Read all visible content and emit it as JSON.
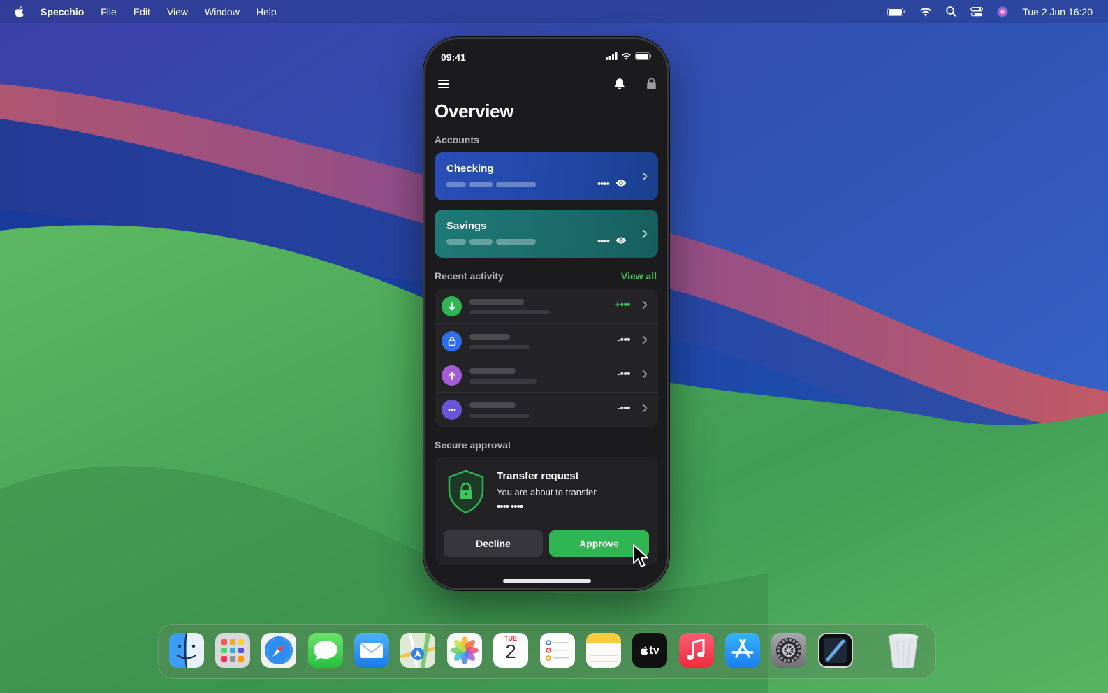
{
  "menubar": {
    "app_name": "Specchio",
    "menus": [
      "File",
      "Edit",
      "View",
      "Window",
      "Help"
    ],
    "clock": "Tue 2 Jun  16:20"
  },
  "phone": {
    "status_time": "09:41",
    "title": "Overview",
    "accounts_label": "Accounts",
    "accounts": [
      {
        "name": "Checking",
        "masked": "••••"
      },
      {
        "name": "Savings",
        "masked": "••••"
      }
    ],
    "recent_label": "Recent activity",
    "view_all": "View all",
    "activity": [
      {
        "icon": "arrow-down-icon",
        "amount": "+•••",
        "color": "#2fb552"
      },
      {
        "icon": "bag-icon",
        "amount": "-•••",
        "color": "#2d6fe8"
      },
      {
        "icon": "arrow-up-icon",
        "amount": "-•••",
        "color": "#a45cd6"
      },
      {
        "icon": "more-icon",
        "amount": "-•••",
        "color": "#6a55d8"
      }
    ],
    "approval_label": "Secure approval",
    "approval": {
      "title": "Transfer request",
      "text": "You are about to transfer",
      "masked": "•••• ••••",
      "decline": "Decline",
      "approve": "Approve"
    }
  },
  "dock": {
    "apps": [
      "finder-icon",
      "launchpad-icon",
      "safari-icon",
      "messages-icon",
      "mail-icon",
      "maps-icon",
      "photos-icon",
      "calendar-icon",
      "reminders-icon",
      "notes-icon",
      "apple-tv-icon",
      "music-icon",
      "app-store-icon",
      "system-settings-icon",
      "specchio-icon",
      "trash-icon"
    ],
    "calendar_month": "TUE",
    "calendar_day": "2",
    "tv_label": "tv"
  },
  "colors": {
    "accent_green": "#2fb552",
    "view_all_green": "#39c45c"
  }
}
